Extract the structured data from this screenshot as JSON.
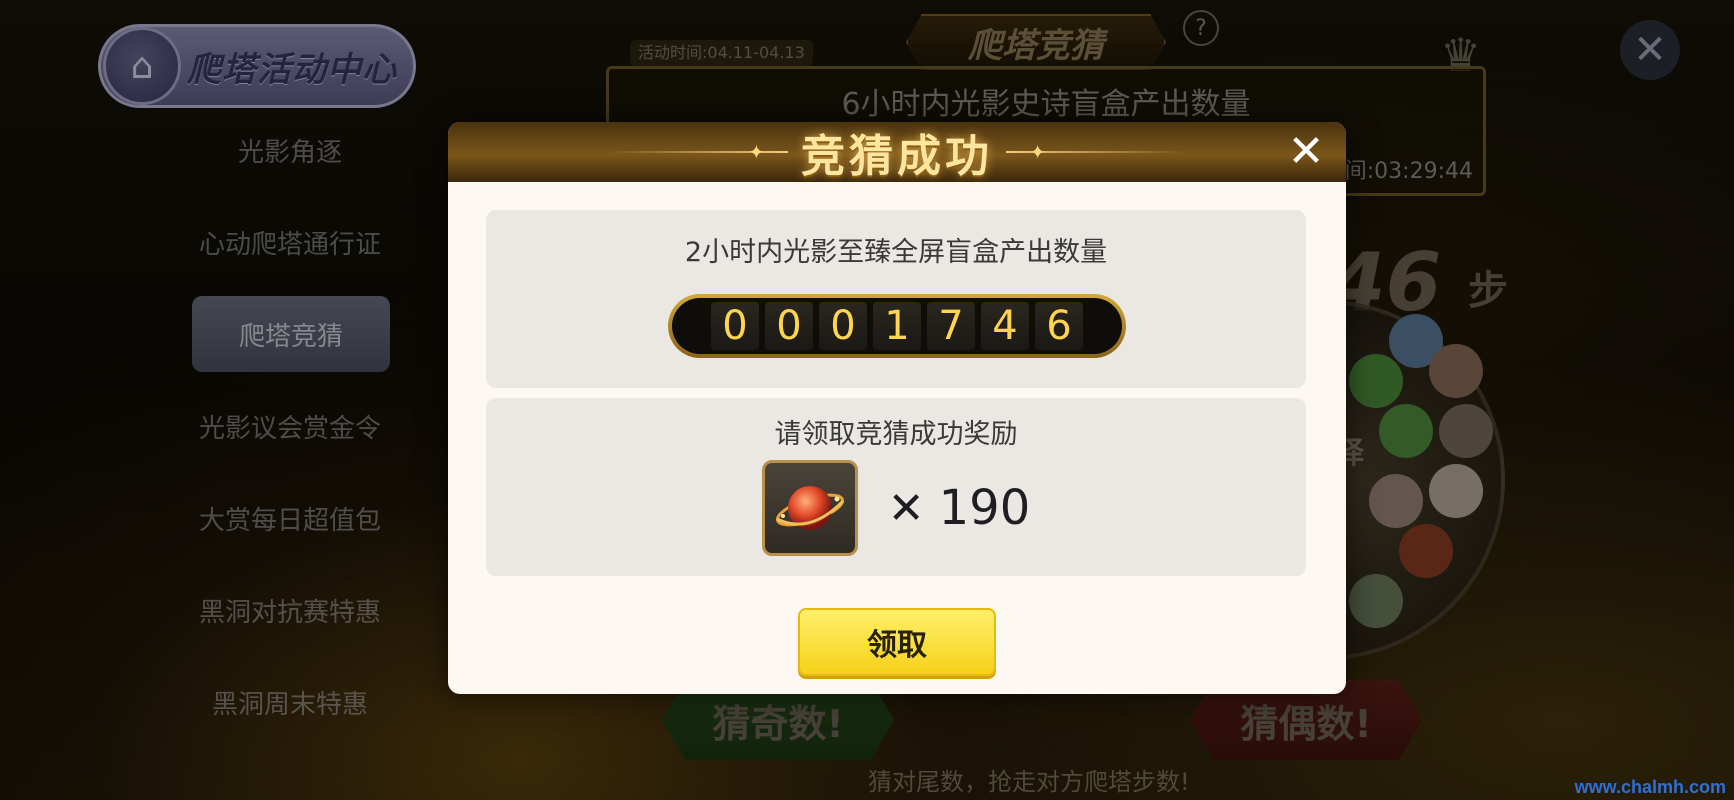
{
  "background": {
    "hub_title": "爬塔活动中心",
    "menu": [
      {
        "label": "光影角逐"
      },
      {
        "label": "心动爬塔通行证"
      },
      {
        "label": "爬塔竞猜",
        "active": true
      },
      {
        "label": "光影议会赏金令"
      },
      {
        "label": "大赏每日超值包"
      },
      {
        "label": "黑洞对抗赛特惠"
      },
      {
        "label": "黑洞周末特惠"
      }
    ],
    "banner_title": "爬塔竞猜",
    "help_label": "?",
    "activity_time": "活动时间:04.11-04.13",
    "panel_title": "6小时内光影史诗盲盒产出数量",
    "countdown": "间:03:29:44",
    "steps_number": "46",
    "steps_unit": "步",
    "wheel_label": "择",
    "guess_odd": "猜奇数!",
    "guess_even": "猜偶数!",
    "footer_hint": "猜对尾数，抢走对方爬塔步数!",
    "close_label": "✕",
    "watermark": "www.chalmh.com"
  },
  "modal": {
    "title": "竞猜成功",
    "close_label": "✕",
    "question": "2小时内光影至臻全屏盲盒产出数量",
    "counter_digits": [
      "0",
      "0",
      "0",
      "1",
      "7",
      "4",
      "6"
    ],
    "reward_prompt": "请领取竞猜成功奖励",
    "reward_icon": "planet-icon",
    "reward_multiplier": "✕",
    "reward_quantity": "190",
    "claim_label": "领取"
  },
  "colors": {
    "accent_gold": "#ffd44f",
    "button_yellow": "#f6d11a",
    "modal_bg": "#fdf9f2"
  }
}
